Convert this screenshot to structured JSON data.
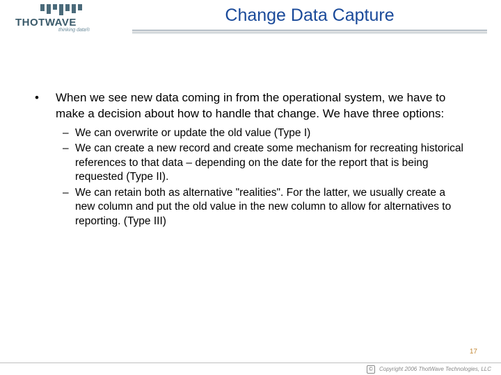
{
  "logo": {
    "name": "THOTWAVE",
    "tagline": "thinking data®"
  },
  "title": "Change Data Capture",
  "bullet_mark": "•",
  "sub_mark": "–",
  "main_bullet": "When we see new data coming in from the operational system, we have to make a decision about how to handle that change. We have three options:",
  "subs": [
    "We can overwrite or update the old value (Type I)",
    "We can create a new record and create some mechanism for recreating historical references to that data – depending on the date for the report that is being requested (Type II).",
    "We can retain both as alternative \"realities\".  For the latter, we usually create a new column and put the old value in the new column to allow for alternatives to reporting. (Type III)"
  ],
  "page_number": "17",
  "footer": {
    "symbol": "©",
    "text": "Copyright 2006 ThotWave Technologies, LLC"
  }
}
